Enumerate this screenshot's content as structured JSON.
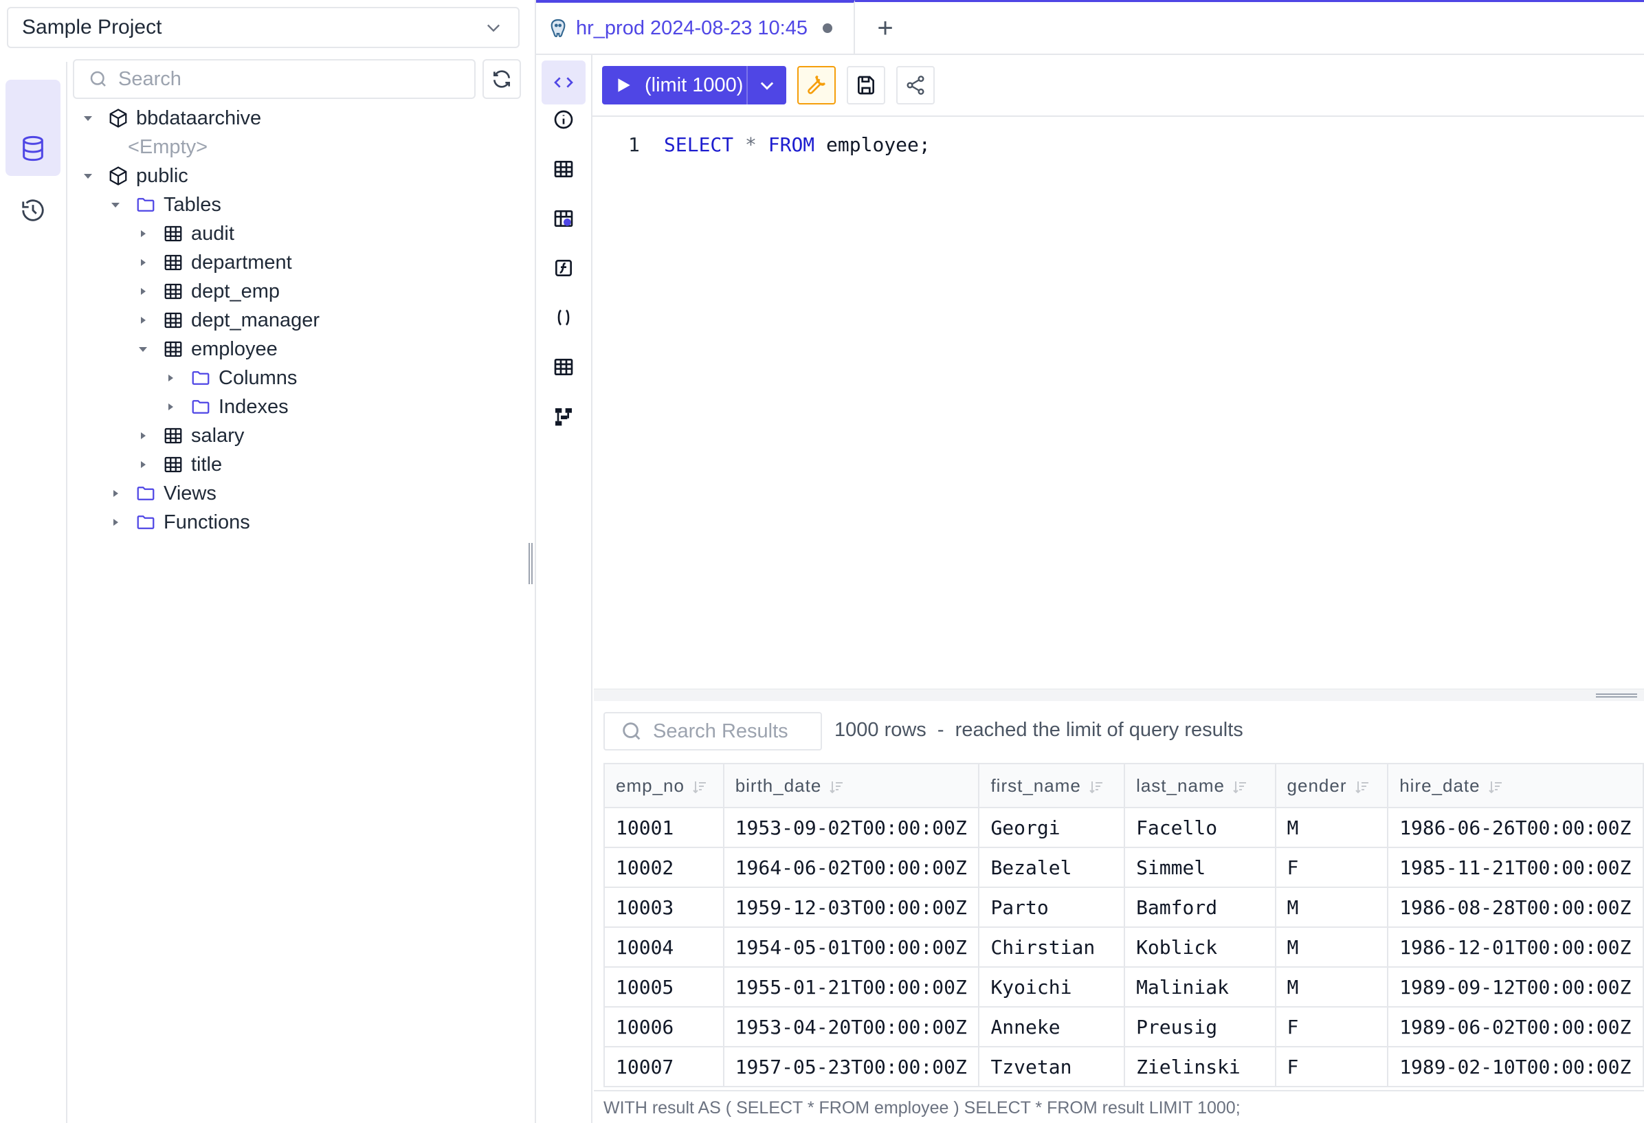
{
  "project": {
    "name": "Sample Project"
  },
  "sidebar": {
    "search_placeholder": "Search"
  },
  "tree": [
    {
      "label": "bbdataarchive",
      "kind": "schema",
      "expanded": true,
      "level": 0
    },
    {
      "label": "<Empty>",
      "kind": "empty",
      "level": 1
    },
    {
      "label": "public",
      "kind": "schema",
      "expanded": true,
      "level": 0
    },
    {
      "label": "Tables",
      "kind": "folder",
      "expanded": true,
      "level": 1
    },
    {
      "label": "audit",
      "kind": "table",
      "expanded": false,
      "level": 2
    },
    {
      "label": "department",
      "kind": "table",
      "expanded": false,
      "level": 2
    },
    {
      "label": "dept_emp",
      "kind": "table",
      "expanded": false,
      "level": 2
    },
    {
      "label": "dept_manager",
      "kind": "table",
      "expanded": false,
      "level": 2
    },
    {
      "label": "employee",
      "kind": "table",
      "expanded": true,
      "level": 2
    },
    {
      "label": "Columns",
      "kind": "folder",
      "expanded": false,
      "level": 3
    },
    {
      "label": "Indexes",
      "kind": "folder",
      "expanded": false,
      "level": 3
    },
    {
      "label": "salary",
      "kind": "table",
      "expanded": false,
      "level": 2
    },
    {
      "label": "title",
      "kind": "table",
      "expanded": false,
      "level": 2
    },
    {
      "label": "Views",
      "kind": "folder",
      "expanded": false,
      "level": 1
    },
    {
      "label": "Functions",
      "kind": "folder",
      "expanded": false,
      "level": 1
    }
  ],
  "tab": {
    "label": "hr_prod 2024-08-23 10:45",
    "add_label": "+"
  },
  "toolbar": {
    "run_label": "(limit 1000)"
  },
  "editor": {
    "line_number": "1",
    "kw1": "SELECT",
    "star": "*",
    "kw2": "FROM",
    "table": "employee;"
  },
  "results": {
    "search_placeholder": "Search Results",
    "info": "1000 rows  -  reached the limit of query results",
    "columns": [
      "emp_no",
      "birth_date",
      "first_name",
      "last_name",
      "gender",
      "hire_date"
    ],
    "rows": [
      [
        "10001",
        "1953-09-02T00:00:00Z",
        "Georgi",
        "Facello",
        "M",
        "1986-06-26T00:00:00Z"
      ],
      [
        "10002",
        "1964-06-02T00:00:00Z",
        "Bezalel",
        "Simmel",
        "F",
        "1985-11-21T00:00:00Z"
      ],
      [
        "10003",
        "1959-12-03T00:00:00Z",
        "Parto",
        "Bamford",
        "M",
        "1986-08-28T00:00:00Z"
      ],
      [
        "10004",
        "1954-05-01T00:00:00Z",
        "Chirstian",
        "Koblick",
        "M",
        "1986-12-01T00:00:00Z"
      ],
      [
        "10005",
        "1955-01-21T00:00:00Z",
        "Kyoichi",
        "Maliniak",
        "M",
        "1989-09-12T00:00:00Z"
      ],
      [
        "10006",
        "1953-04-20T00:00:00Z",
        "Anneke",
        "Preusig",
        "F",
        "1989-06-02T00:00:00Z"
      ],
      [
        "10007",
        "1957-05-23T00:00:00Z",
        "Tzvetan",
        "Zielinski",
        "F",
        "1989-02-10T00:00:00Z"
      ]
    ],
    "footer_sql": "WITH result AS ( SELECT * FROM employee ) SELECT * FROM result LIMIT 1000;"
  },
  "colors": {
    "accent": "#4f46e5",
    "accent_soft": "#e8e7fb",
    "warn": "#f59e0b",
    "border": "#e5e7eb"
  },
  "icons": {
    "rail": [
      "sql-file-icon",
      "database-icon",
      "history-icon"
    ],
    "editor_rail": [
      "code-icon",
      "info-icon",
      "table-icon",
      "table-settings-icon",
      "function-icon",
      "parentheses-icon",
      "grid-icon",
      "diagram-icon"
    ]
  }
}
